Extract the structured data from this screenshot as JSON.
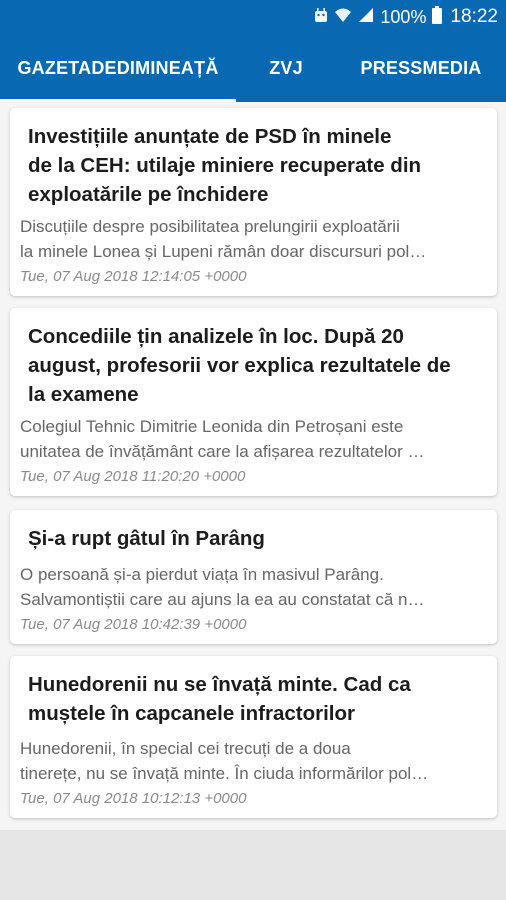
{
  "status_bar": {
    "battery_percent": "100%",
    "time": "18:22"
  },
  "tabs": [
    {
      "label": "GAZETADEDIMINEAȚĂ",
      "active": true
    },
    {
      "label": "ZVJ",
      "active": false
    },
    {
      "label": "PRESSMEDIA",
      "active": false
    }
  ],
  "articles": [
    {
      "title_lines": [
        "Investițiile anunțate de PSD în minele",
        "de la CEH: utilaje miniere recuperate din",
        "exploatările pe închidere"
      ],
      "desc_lines": [
        "Discuțiile despre posibilitatea prelungirii exploatării",
        "la minele Lonea și Lupeni rămân doar discursuri pol…"
      ],
      "date": "Tue, 07 Aug 2018 12:14:05 +0000"
    },
    {
      "title_lines": [
        "Concediile țin analizele în loc. După 20",
        "august, profesorii vor explica rezultatele de",
        "la examene"
      ],
      "desc_lines": [
        "Colegiul Tehnic Dimitrie Leonida din Petroșani este",
        "unitatea de învățământ care la afișarea rezultatelor …"
      ],
      "date": "Tue, 07 Aug 2018 11:20:20 +0000"
    },
    {
      "title_lines": [
        "Și-a rupt gâtul în Parâng"
      ],
      "desc_lines": [
        "O persoană și-a pierdut viața în masivul Parâng.",
        "Salvamontiștii care au ajuns la ea au constatat că n…"
      ],
      "date": "Tue, 07 Aug 2018 10:42:39 +0000"
    },
    {
      "title_lines": [
        "Hunedorenii nu se învață minte. Cad ca",
        "muștele în capcanele infractorilor"
      ],
      "desc_lines": [
        "Hunedorenii, în special cei trecuți de a doua",
        "tinerețe, nu se învață minte. În ciuda informărilor pol…"
      ],
      "date": "Tue, 07 Aug 2018 10:12:13 +0000"
    }
  ]
}
